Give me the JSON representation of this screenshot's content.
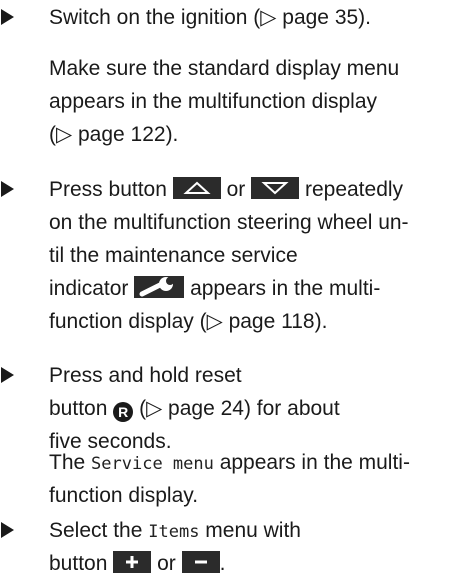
{
  "step1": {
    "a": "Switch on the ignition (▷ page 35)."
  },
  "note1": {
    "l1": "Make sure the standard display menu",
    "l2": "appears in the multifunction display",
    "l3": "(▷ page 122)."
  },
  "step2": {
    "a": "Press button",
    "or": "or",
    "b": "repeatedly",
    "l2": "on the multifunction steering wheel un-",
    "l3": "til the maintenance service",
    "l4a": "indicator",
    "l4b": "appears in the multi-",
    "l5": "function display (▷ page 118)."
  },
  "step3": {
    "l1": "Press and hold reset",
    "l2a": "button",
    "reset_glyph": "R",
    "l2b": "(▷ page 24) for about",
    "l3": "five seconds."
  },
  "note2": {
    "a": "The",
    "menu": "Service menu",
    "b": "appears in the multi-",
    "l2": "function display."
  },
  "step4": {
    "a": "Select the",
    "menu": "Items",
    "b": "menu with",
    "l2a": "button",
    "or": "or",
    "end": "."
  },
  "icons": {
    "bullet": "triangle-bullet-icon",
    "up": "arrow-up-button-icon",
    "down": "arrow-down-button-icon",
    "wrench": "wrench-icon",
    "plus": "plus-button-icon",
    "minus": "minus-button-icon"
  }
}
